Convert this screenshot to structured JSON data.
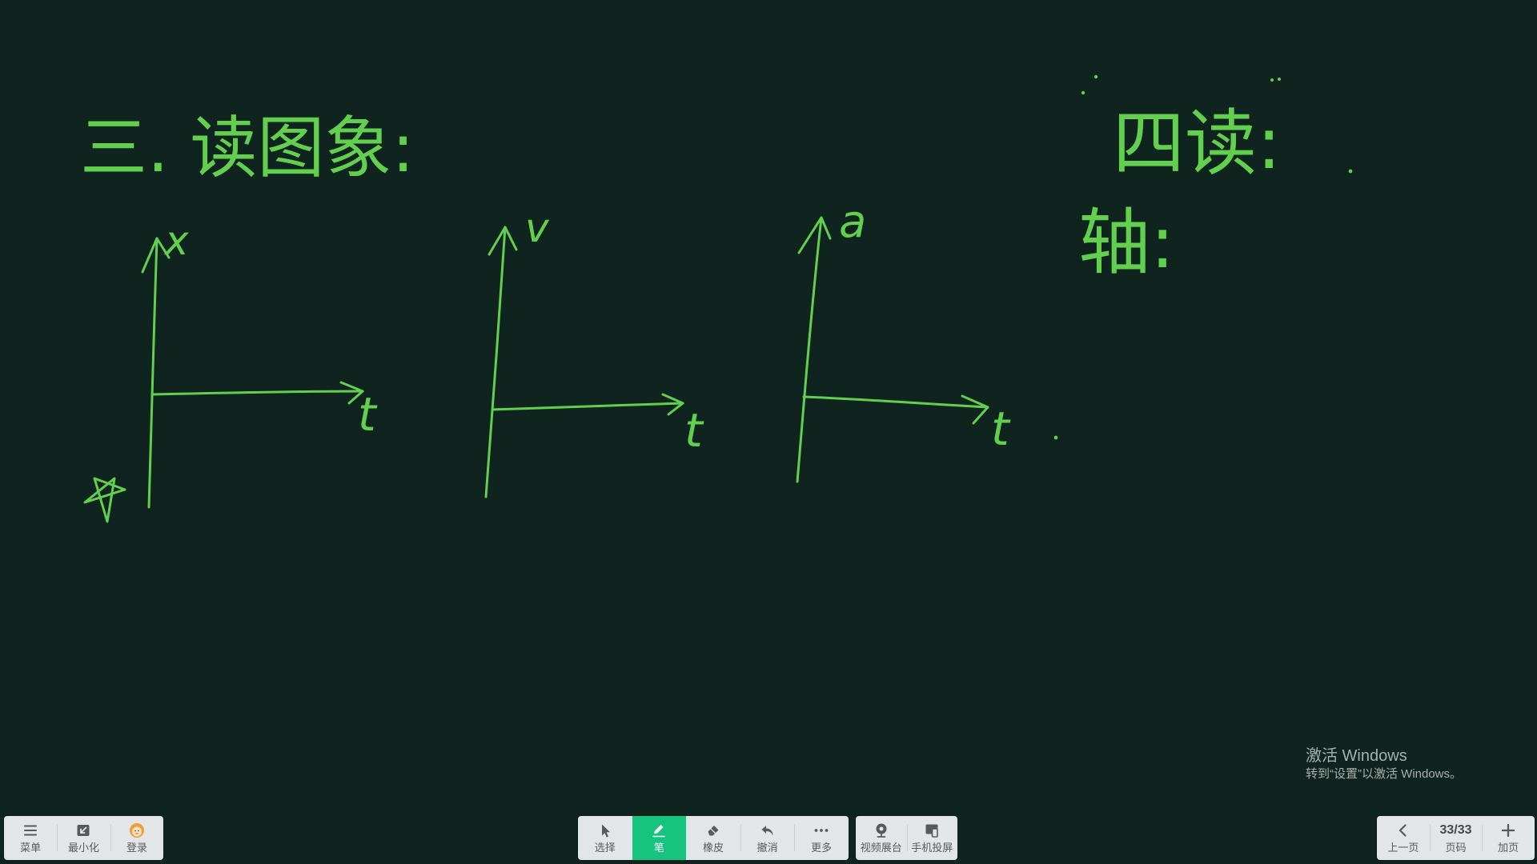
{
  "board": {
    "background": "#0f241e",
    "ink_color": "#62cf4f",
    "heading_3": "三. 读图象:",
    "heading_4": "四读:",
    "axis_note": "轴:",
    "graphs": [
      {
        "y_label": "x",
        "x_label": "t"
      },
      {
        "y_label": "v",
        "x_label": "t"
      },
      {
        "y_label": "a",
        "x_label": "t"
      }
    ]
  },
  "toolbar": {
    "left": {
      "menu": "菜单",
      "menu_icon": "menu-icon",
      "minimize": "最小化",
      "minimize_icon": "minimize-icon",
      "login": "登录",
      "login_icon": "avatar-icon"
    },
    "tools": {
      "select": "选择",
      "select_icon": "cursor-icon",
      "pen": "笔",
      "pen_icon": "pen-icon",
      "pen_active": true,
      "eraser": "橡皮",
      "eraser_icon": "eraser-icon",
      "undo": "撤消",
      "undo_icon": "undo-icon",
      "more": "更多",
      "more_icon": "more-dots-icon",
      "active_color": "#17c47f"
    },
    "media": {
      "visualizer": "视频展台",
      "visualizer_icon": "camera-icon",
      "cast": "手机投屏",
      "cast_icon": "phone-cast-icon"
    },
    "pager": {
      "prev": "上一页",
      "prev_icon": "chevron-left-icon",
      "page": "33/33",
      "page_label": "页码",
      "add": "加页",
      "add_icon": "plus-icon"
    }
  },
  "watermark": {
    "title": "激活 Windows",
    "subtitle": "转到“设置”以激活 Windows。"
  }
}
